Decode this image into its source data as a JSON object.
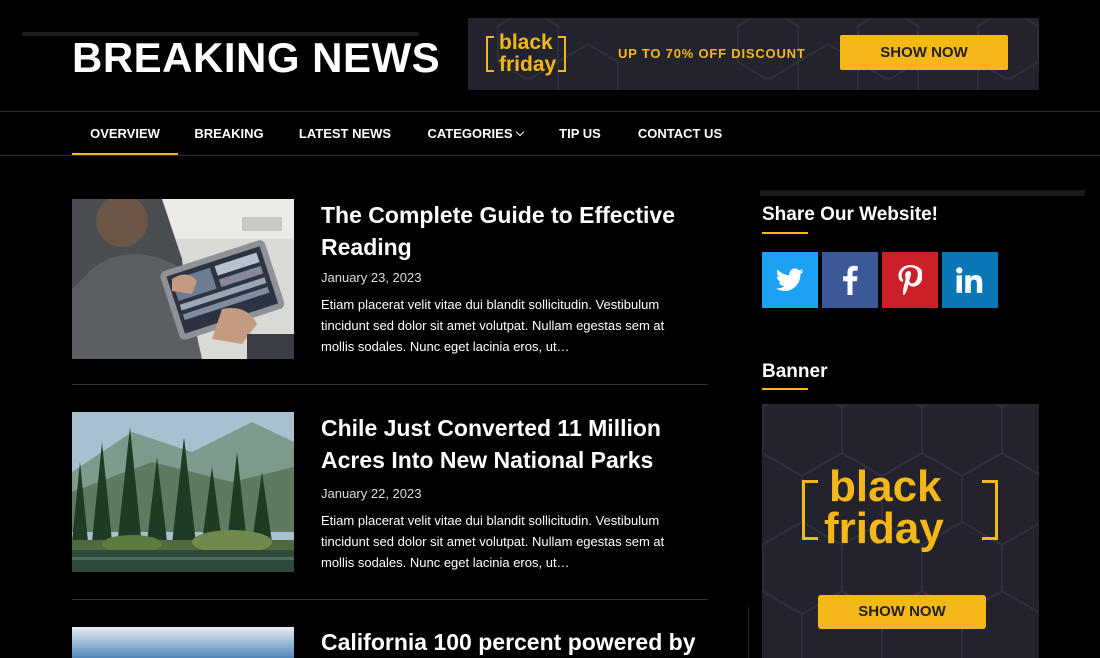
{
  "site": {
    "title": "BREAKING NEWS"
  },
  "top_banner": {
    "brand_line1": "black",
    "brand_line2": "friday",
    "discount": "UP TO 70% OFF DISCOUNT",
    "cta": "SHOW NOW"
  },
  "nav": {
    "items": [
      {
        "label": "OVERVIEW",
        "active": true
      },
      {
        "label": "BREAKING"
      },
      {
        "label": "LATEST NEWS"
      },
      {
        "label": "CATEGORIES",
        "has_dropdown": true
      },
      {
        "label": "TIP US"
      },
      {
        "label": "CONTACT US"
      }
    ]
  },
  "articles": [
    {
      "title": "The Complete Guide to Effective Reading",
      "date": "January 23, 2023",
      "excerpt": "Etiam placerat velit vitae dui blandit sollicitudin. Vestibulum tincidunt sed dolor sit amet volutpat. Nullam egestas sem at mollis sodales. Nunc eget lacinia eros, ut…",
      "thumbnail": "person-using-tablet"
    },
    {
      "title": "Chile Just Converted 11 Million Acres Into New National Parks",
      "date": "January 22, 2023",
      "excerpt": "Etiam placerat velit vitae dui blandit sollicitudin. Vestibulum tincidunt sed dolor sit amet volutpat. Nullam egestas sem at mollis sodales. Nunc eget lacinia eros, ut…",
      "thumbnail": "forest-lake"
    },
    {
      "title": "California 100 percent powered by",
      "thumbnail": "sky"
    }
  ],
  "sidebar": {
    "share_title": "Share Our Website!",
    "share_buttons": [
      {
        "icon": "twitter-icon",
        "color": "#1da1f2"
      },
      {
        "icon": "facebook-icon",
        "color": "#3b5998"
      },
      {
        "icon": "pinterest-icon",
        "color": "#cb2027"
      },
      {
        "icon": "linkedin-icon",
        "color": "#0a77b5"
      }
    ],
    "banner_title": "Banner",
    "banner": {
      "brand_line1": "black",
      "brand_line2": "friday",
      "cta": "SHOW NOW"
    }
  },
  "colors": {
    "accent": "#f6b818",
    "background": "#000000",
    "banner_bg": "#23232e"
  }
}
